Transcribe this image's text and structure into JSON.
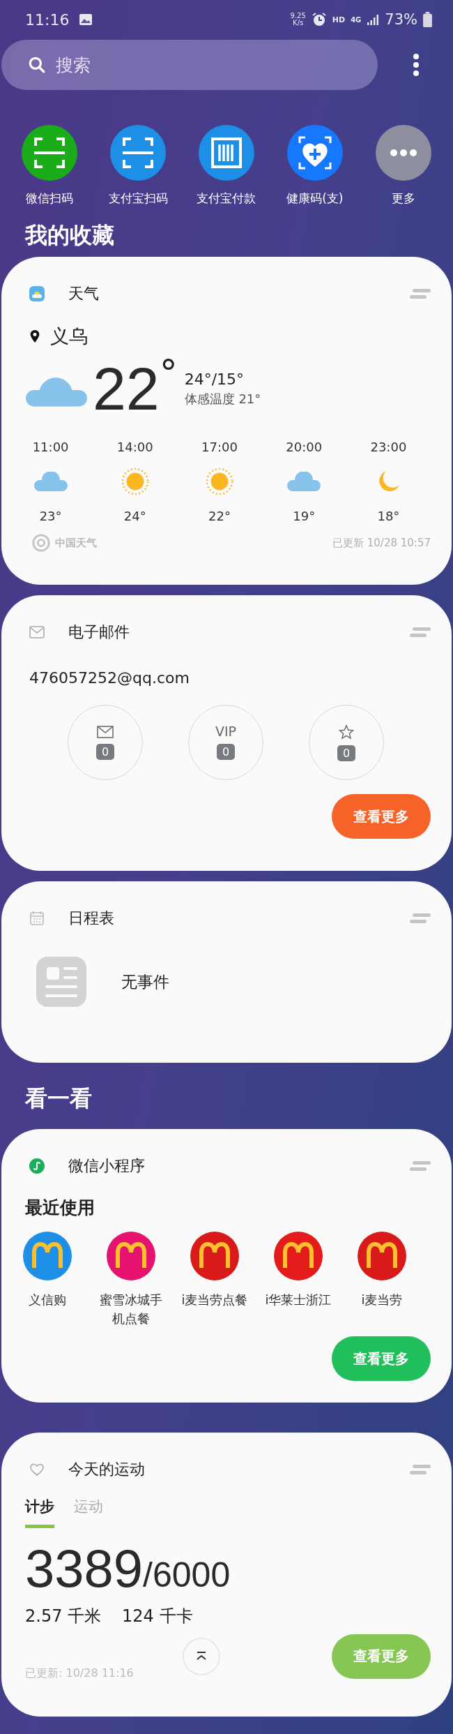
{
  "status_bar": {
    "time": "11:16",
    "net_speed": "9.25",
    "net_unit": "K/s",
    "hd": "HD",
    "network": "4G",
    "battery": "73%"
  },
  "search": {
    "placeholder": "搜索"
  },
  "shortcuts": [
    {
      "label": "微信扫码",
      "kind": "scan",
      "color": "#1aad19"
    },
    {
      "label": "支付宝扫码",
      "kind": "scan",
      "color": "#1e8fe6"
    },
    {
      "label": "支付宝付款",
      "kind": "barcode",
      "color": "#1e8fe6"
    },
    {
      "label": "健康码(支)",
      "kind": "health",
      "color": "#1677ff"
    },
    {
      "label": "更多",
      "kind": "more",
      "color": "#8e8f9e"
    }
  ],
  "favorites_title": "我的收藏",
  "weather": {
    "title": "天气",
    "city": "义乌",
    "temp": "22",
    "degree": "°",
    "range": "24°/15°",
    "feels": "体感温度 21°",
    "hours": [
      {
        "time": "11:00",
        "kind": "cloud",
        "temp": "23°"
      },
      {
        "time": "14:00",
        "kind": "sun",
        "temp": "24°"
      },
      {
        "time": "17:00",
        "kind": "sun",
        "temp": "22°"
      },
      {
        "time": "20:00",
        "kind": "cloud",
        "temp": "19°"
      },
      {
        "time": "23:00",
        "kind": "moon",
        "temp": "18°"
      }
    ],
    "source": "中国天气",
    "updated": "已更新 10/28 10:57"
  },
  "email": {
    "title": "电子邮件",
    "address": "476057252@qq.com",
    "stats": [
      {
        "kind": "mail",
        "count": "0"
      },
      {
        "kind": "text",
        "label": "VIP",
        "count": "0"
      },
      {
        "kind": "star",
        "count": "0"
      }
    ],
    "more_button": "查看更多"
  },
  "calendar": {
    "title": "日程表",
    "empty": "无事件"
  },
  "discover_title": "看一看",
  "mini_programs": {
    "title": "微信小程序",
    "section": "最近使用",
    "apps": [
      {
        "name": "义信购",
        "color": "#1e8fe6"
      },
      {
        "name": "蜜雪冰城手机点餐",
        "color": "#e5126f"
      },
      {
        "name": "i麦当劳点餐",
        "color": "#d91a1a"
      },
      {
        "name": "i华莱士浙江",
        "color": "#e31b1b"
      },
      {
        "name": "i麦当劳",
        "color": "#d91a1a"
      }
    ],
    "more_button": "查看更多"
  },
  "exercise": {
    "title": "今天的运动",
    "tabs": [
      {
        "label": "计步",
        "selected": true
      },
      {
        "label": "运动",
        "selected": false
      }
    ],
    "steps": "3389",
    "goal": "/6000",
    "distance": "2.57 千米",
    "calories": "124 千卡",
    "updated": "已更新:  10/28 11:16",
    "more_button": "查看更多"
  }
}
